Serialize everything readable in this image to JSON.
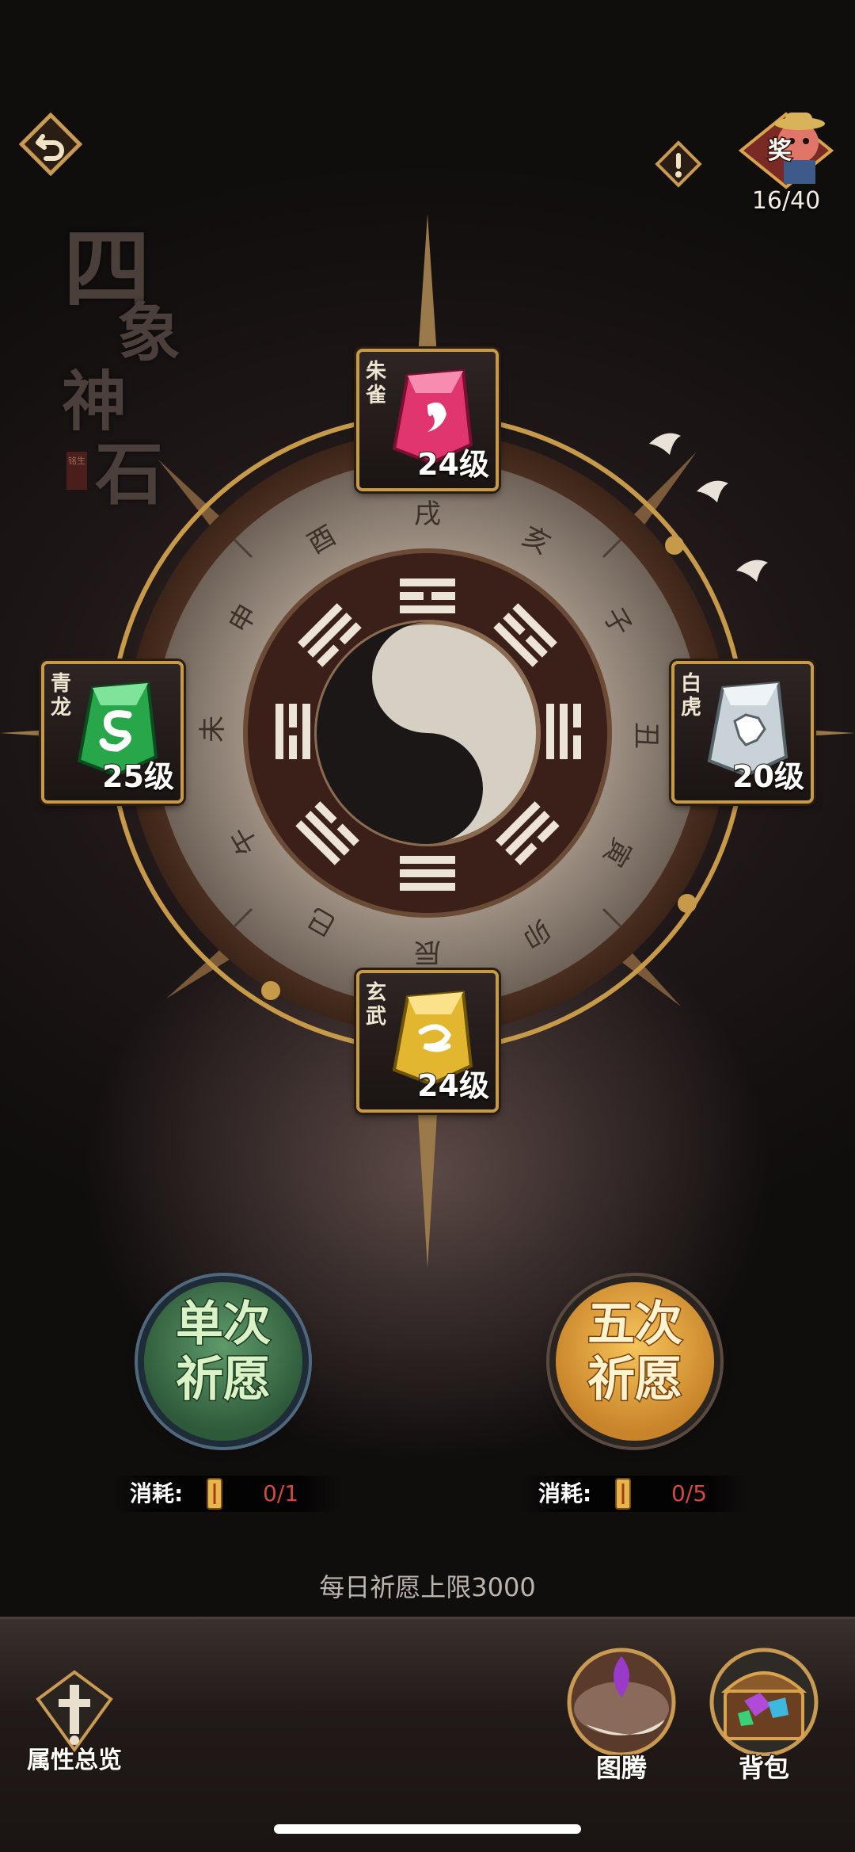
{
  "top_bar": {
    "back_icon": "back-arrow-icon",
    "alert_icon": "exclamation-icon",
    "reward_label": "奖",
    "reward_count": "16/40"
  },
  "title": [
    "四",
    "象",
    "神",
    "石"
  ],
  "title_seal": "铭生",
  "stones": [
    {
      "name": "朱雀",
      "level": "24级",
      "color": "#e0356f"
    },
    {
      "name": "青龙",
      "level": "25级",
      "color": "#27a64a"
    },
    {
      "name": "白虎",
      "level": "20级",
      "color": "#c9d2d6"
    },
    {
      "name": "玄武",
      "level": "24级",
      "color": "#e2b62e"
    }
  ],
  "wheel_glyphs": [
    "戌",
    "亥",
    "子",
    "丑",
    "寅",
    "卯",
    "辰",
    "巳",
    "午",
    "未",
    "申",
    "酉"
  ],
  "wish": {
    "single": {
      "label_line1": "单次",
      "label_line2": "祈愿",
      "cost_label": "消耗:",
      "cost_value": "0/1"
    },
    "five": {
      "label_line1": "五次",
      "label_line2": "祈愿",
      "cost_label": "消耗:",
      "cost_value": "0/5"
    }
  },
  "daily_limit": "每日祈愿上限3000",
  "bottom": {
    "attributes_label": "属性总览",
    "totem_label": "图腾",
    "bag_label": "背包"
  }
}
